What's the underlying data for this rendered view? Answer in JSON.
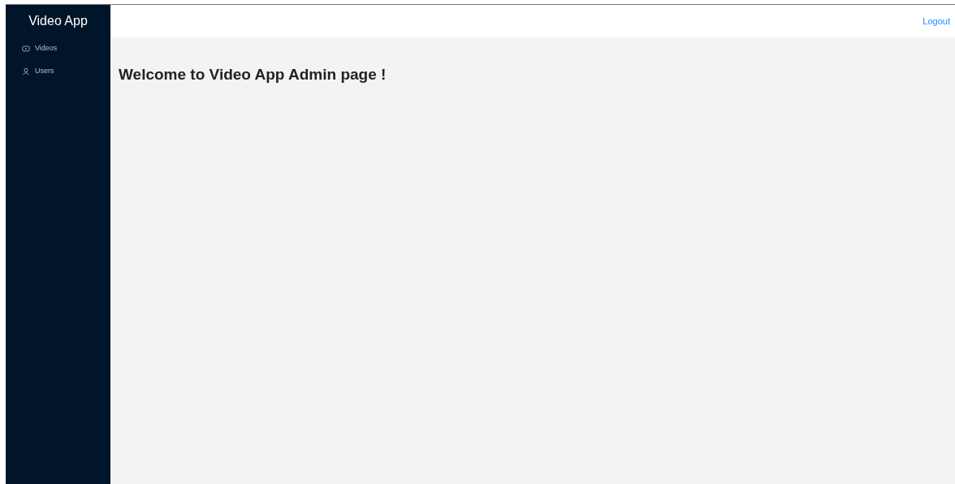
{
  "sidebar": {
    "title": "Video App",
    "items": [
      {
        "label": "Videos",
        "kind": "video"
      },
      {
        "label": "Users",
        "kind": "user"
      }
    ]
  },
  "header": {
    "logout": "Logout"
  },
  "main": {
    "heading": "Welcome to Video App Admin page !"
  }
}
